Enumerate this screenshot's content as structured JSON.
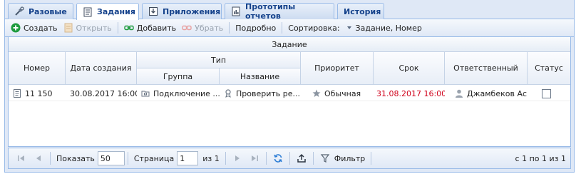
{
  "tabs": [
    {
      "label": "Разовые",
      "icon": "tools-icon"
    },
    {
      "label": "Задания",
      "icon": "document-icon",
      "active": true
    },
    {
      "label": "Приложения",
      "icon": "download-icon"
    },
    {
      "label": "Прототипы отчетов",
      "icon": "report-icon"
    },
    {
      "label": "История",
      "icon": ""
    }
  ],
  "toolbar": {
    "create": "Создать",
    "open": "Открыть",
    "add": "Добавить",
    "remove": "Убрать",
    "details": "Подробно",
    "sort_label": "Сортировка:",
    "sort_value": "Задание, Номер"
  },
  "grid": {
    "title": "Задание",
    "columns": {
      "number": "Номер",
      "created": "Дата создания",
      "type": "Тип",
      "group": "Группа",
      "name": "Название",
      "priority": "Приоритет",
      "deadline": "Срок",
      "responsible": "Ответственный",
      "status": "Статус"
    },
    "rows": [
      {
        "number": "11 150",
        "created": "30.08.2017 16:00",
        "group": "Подключение ...",
        "name": "Проверить ре...",
        "priority": "Обычная",
        "deadline": "31.08.2017 16:00",
        "responsible": "Джамбеков Ас...",
        "status_checked": false
      }
    ]
  },
  "pager": {
    "show_label": "Показать",
    "page_size": "50",
    "page_label": "Страница",
    "page": "1",
    "of_pages": "из 1",
    "filter": "Фильтр",
    "summary": "с 1 по 1 из 1"
  },
  "colors": {
    "deadline_overdue": "#d0021b",
    "accent": "#15428b",
    "border": "#99bbe8"
  }
}
